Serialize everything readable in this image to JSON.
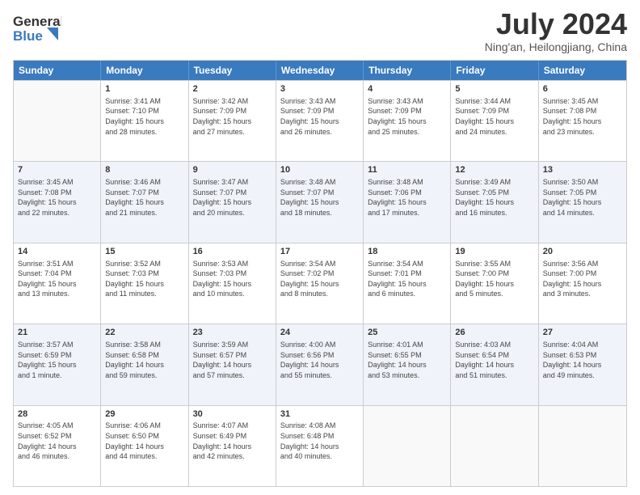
{
  "header": {
    "logo_line1": "General",
    "logo_line2": "Blue",
    "title": "July 2024",
    "location": "Ning'an, Heilongjiang, China"
  },
  "calendar": {
    "days_of_week": [
      "Sunday",
      "Monday",
      "Tuesday",
      "Wednesday",
      "Thursday",
      "Friday",
      "Saturday"
    ],
    "rows": [
      [
        {
          "day": "",
          "info": ""
        },
        {
          "day": "1",
          "info": "Sunrise: 3:41 AM\nSunset: 7:10 PM\nDaylight: 15 hours\nand 28 minutes."
        },
        {
          "day": "2",
          "info": "Sunrise: 3:42 AM\nSunset: 7:09 PM\nDaylight: 15 hours\nand 27 minutes."
        },
        {
          "day": "3",
          "info": "Sunrise: 3:43 AM\nSunset: 7:09 PM\nDaylight: 15 hours\nand 26 minutes."
        },
        {
          "day": "4",
          "info": "Sunrise: 3:43 AM\nSunset: 7:09 PM\nDaylight: 15 hours\nand 25 minutes."
        },
        {
          "day": "5",
          "info": "Sunrise: 3:44 AM\nSunset: 7:09 PM\nDaylight: 15 hours\nand 24 minutes."
        },
        {
          "day": "6",
          "info": "Sunrise: 3:45 AM\nSunset: 7:08 PM\nDaylight: 15 hours\nand 23 minutes."
        }
      ],
      [
        {
          "day": "7",
          "info": "Sunrise: 3:45 AM\nSunset: 7:08 PM\nDaylight: 15 hours\nand 22 minutes."
        },
        {
          "day": "8",
          "info": "Sunrise: 3:46 AM\nSunset: 7:07 PM\nDaylight: 15 hours\nand 21 minutes."
        },
        {
          "day": "9",
          "info": "Sunrise: 3:47 AM\nSunset: 7:07 PM\nDaylight: 15 hours\nand 20 minutes."
        },
        {
          "day": "10",
          "info": "Sunrise: 3:48 AM\nSunset: 7:07 PM\nDaylight: 15 hours\nand 18 minutes."
        },
        {
          "day": "11",
          "info": "Sunrise: 3:48 AM\nSunset: 7:06 PM\nDaylight: 15 hours\nand 17 minutes."
        },
        {
          "day": "12",
          "info": "Sunrise: 3:49 AM\nSunset: 7:05 PM\nDaylight: 15 hours\nand 16 minutes."
        },
        {
          "day": "13",
          "info": "Sunrise: 3:50 AM\nSunset: 7:05 PM\nDaylight: 15 hours\nand 14 minutes."
        }
      ],
      [
        {
          "day": "14",
          "info": "Sunrise: 3:51 AM\nSunset: 7:04 PM\nDaylight: 15 hours\nand 13 minutes."
        },
        {
          "day": "15",
          "info": "Sunrise: 3:52 AM\nSunset: 7:03 PM\nDaylight: 15 hours\nand 11 minutes."
        },
        {
          "day": "16",
          "info": "Sunrise: 3:53 AM\nSunset: 7:03 PM\nDaylight: 15 hours\nand 10 minutes."
        },
        {
          "day": "17",
          "info": "Sunrise: 3:54 AM\nSunset: 7:02 PM\nDaylight: 15 hours\nand 8 minutes."
        },
        {
          "day": "18",
          "info": "Sunrise: 3:54 AM\nSunset: 7:01 PM\nDaylight: 15 hours\nand 6 minutes."
        },
        {
          "day": "19",
          "info": "Sunrise: 3:55 AM\nSunset: 7:00 PM\nDaylight: 15 hours\nand 5 minutes."
        },
        {
          "day": "20",
          "info": "Sunrise: 3:56 AM\nSunset: 7:00 PM\nDaylight: 15 hours\nand 3 minutes."
        }
      ],
      [
        {
          "day": "21",
          "info": "Sunrise: 3:57 AM\nSunset: 6:59 PM\nDaylight: 15 hours\nand 1 minute."
        },
        {
          "day": "22",
          "info": "Sunrise: 3:58 AM\nSunset: 6:58 PM\nDaylight: 14 hours\nand 59 minutes."
        },
        {
          "day": "23",
          "info": "Sunrise: 3:59 AM\nSunset: 6:57 PM\nDaylight: 14 hours\nand 57 minutes."
        },
        {
          "day": "24",
          "info": "Sunrise: 4:00 AM\nSunset: 6:56 PM\nDaylight: 14 hours\nand 55 minutes."
        },
        {
          "day": "25",
          "info": "Sunrise: 4:01 AM\nSunset: 6:55 PM\nDaylight: 14 hours\nand 53 minutes."
        },
        {
          "day": "26",
          "info": "Sunrise: 4:03 AM\nSunset: 6:54 PM\nDaylight: 14 hours\nand 51 minutes."
        },
        {
          "day": "27",
          "info": "Sunrise: 4:04 AM\nSunset: 6:53 PM\nDaylight: 14 hours\nand 49 minutes."
        }
      ],
      [
        {
          "day": "28",
          "info": "Sunrise: 4:05 AM\nSunset: 6:52 PM\nDaylight: 14 hours\nand 46 minutes."
        },
        {
          "day": "29",
          "info": "Sunrise: 4:06 AM\nSunset: 6:50 PM\nDaylight: 14 hours\nand 44 minutes."
        },
        {
          "day": "30",
          "info": "Sunrise: 4:07 AM\nSunset: 6:49 PM\nDaylight: 14 hours\nand 42 minutes."
        },
        {
          "day": "31",
          "info": "Sunrise: 4:08 AM\nSunset: 6:48 PM\nDaylight: 14 hours\nand 40 minutes."
        },
        {
          "day": "",
          "info": ""
        },
        {
          "day": "",
          "info": ""
        },
        {
          "day": "",
          "info": ""
        }
      ]
    ]
  }
}
